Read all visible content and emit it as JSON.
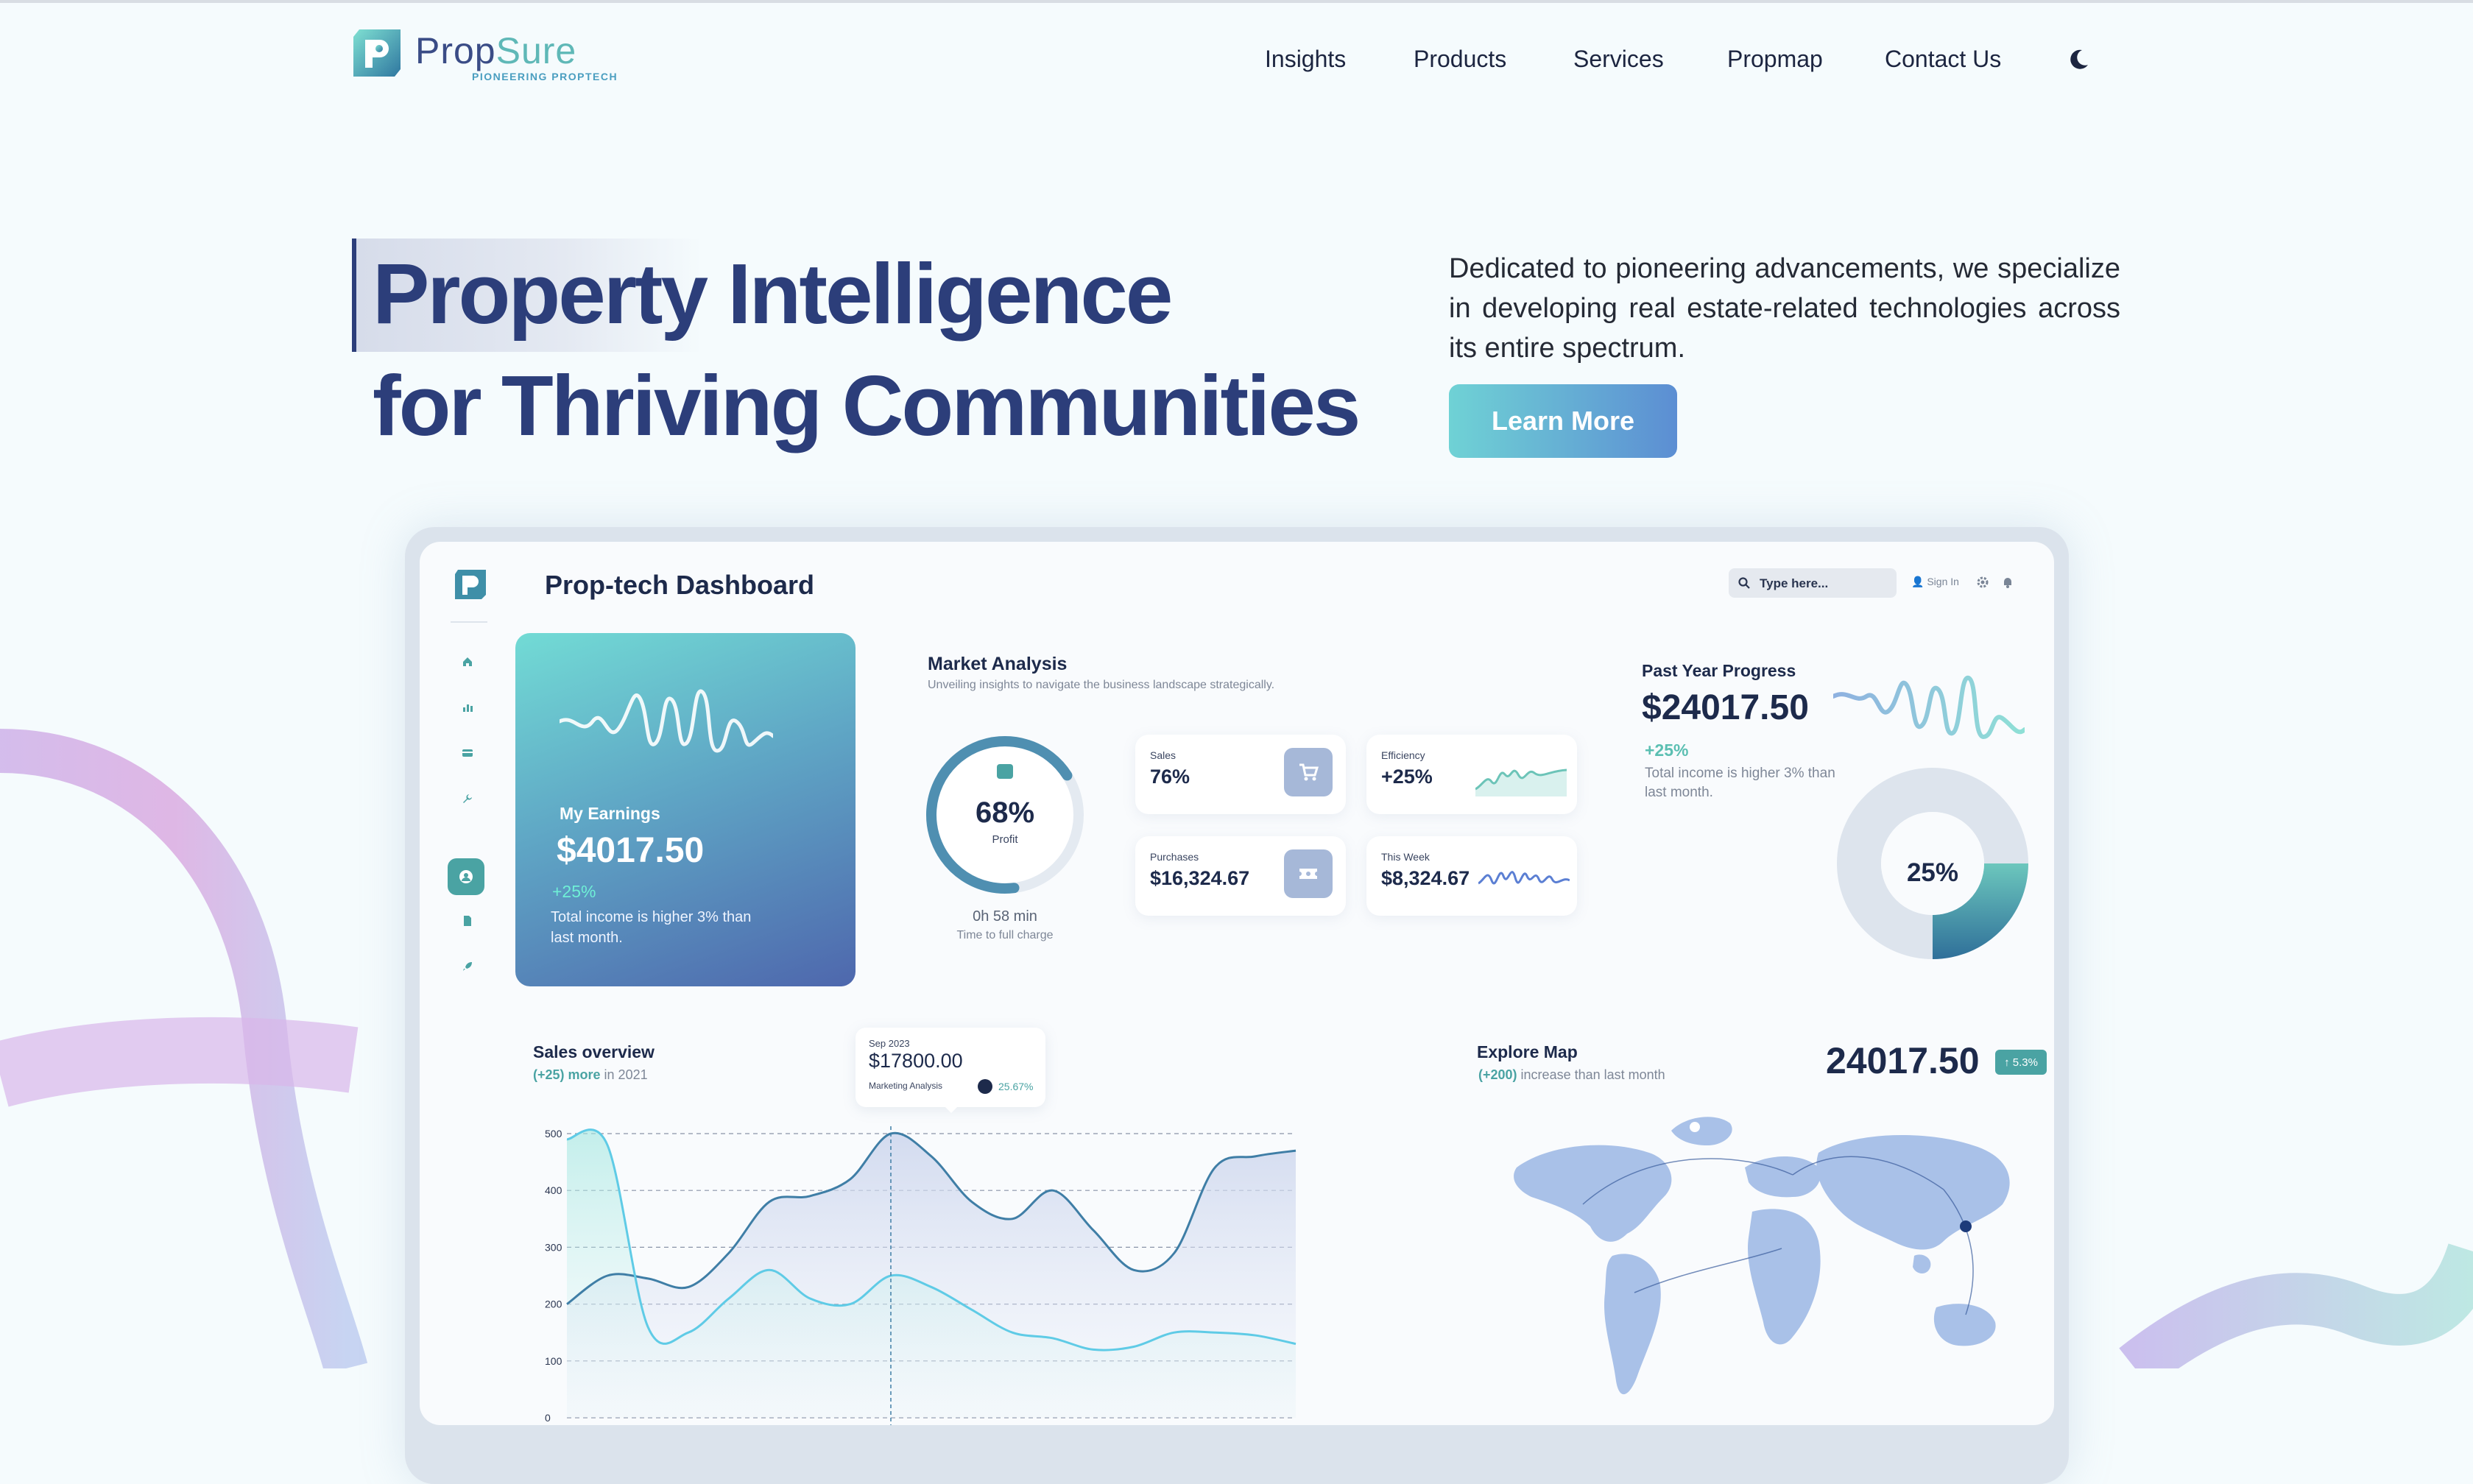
{
  "brand": {
    "name_main": "Prop",
    "name_accent": "Sure",
    "tagline": "PIONEERING PROPTECH"
  },
  "nav": {
    "items": [
      "Insights",
      "Products",
      "Services",
      "Propmap",
      "Contact Us"
    ]
  },
  "hero": {
    "line1_highlight": "Property",
    "line1_rest": "Intelligence",
    "line2": "for Thriving Communities",
    "description": "Dedicated to pioneering advancements, we specialize in developing real estate-related technologies across its entire spectrum.",
    "cta_label": "Learn More"
  },
  "dashboard": {
    "title": "Prop-tech Dashboard",
    "search_placeholder": "Type here...",
    "signin_label": "Sign In",
    "earnings": {
      "label": "My Earnings",
      "value": "$4017.50",
      "change": "+25%",
      "note": "Total income is higher 3% than last month."
    },
    "market": {
      "title": "Market Analysis",
      "subtitle": "Unveiling insights to navigate the business landscape strategically.",
      "gauge_value": "68%",
      "gauge_fraction": 0.68,
      "gauge_label": "Profit",
      "time_value": "0h 58 min",
      "time_label": "Time to full charge",
      "stats": [
        {
          "label": "Sales",
          "value": "76%",
          "icon": "cart-icon"
        },
        {
          "label": "Efficiency",
          "value": "+25%",
          "icon": "sparkline"
        },
        {
          "label": "Purchases",
          "value": "$16,324.67",
          "icon": "ticket-icon"
        },
        {
          "label": "This Week",
          "value": "$8,324.67",
          "icon": "sparkline"
        }
      ]
    },
    "progress": {
      "title": "Past Year Progress",
      "value": "$24017.50",
      "change": "+25%",
      "note": "Total income is higher 3% than last month.",
      "donut_value": "25%",
      "donut_fraction": 0.25
    },
    "sales": {
      "title": "Sales overview",
      "sub_accent": "(+25) more",
      "sub_rest": " in 2021",
      "tooltip": {
        "date": "Sep 2023",
        "value": "$17800.00",
        "label": "Marketing Analysis",
        "pct": "25.67%"
      }
    },
    "map": {
      "title": "Explore Map",
      "sub_accent": "(+200)",
      "sub_rest": " increase than last month",
      "value": "24017.50",
      "badge": "5.3%"
    }
  },
  "colors": {
    "primary": "#2c3e7a",
    "teal": "#4aa3a3",
    "accent_light": "#6fd2d5",
    "accent_blue": "#5c8ed3"
  },
  "chart_data": {
    "type": "area",
    "title": "Sales overview",
    "x": [
      0,
      1,
      2,
      3,
      4,
      5,
      6,
      7,
      8,
      9,
      10,
      11,
      12,
      13,
      14,
      15,
      16,
      17,
      18
    ],
    "ylim": [
      0,
      500
    ],
    "yticks": [
      0,
      100,
      200,
      300,
      400,
      500
    ],
    "series": [
      {
        "values": [
          200,
          250,
          245,
          230,
          290,
          380,
          390,
          420,
          500,
          460,
          380,
          350,
          400,
          330,
          260,
          290,
          440,
          460,
          470
        ]
      },
      {
        "values": [
          490,
          480,
          160,
          150,
          210,
          260,
          210,
          200,
          250,
          230,
          190,
          150,
          140,
          120,
          125,
          150,
          150,
          145,
          130
        ]
      }
    ],
    "marker_index": 8
  }
}
